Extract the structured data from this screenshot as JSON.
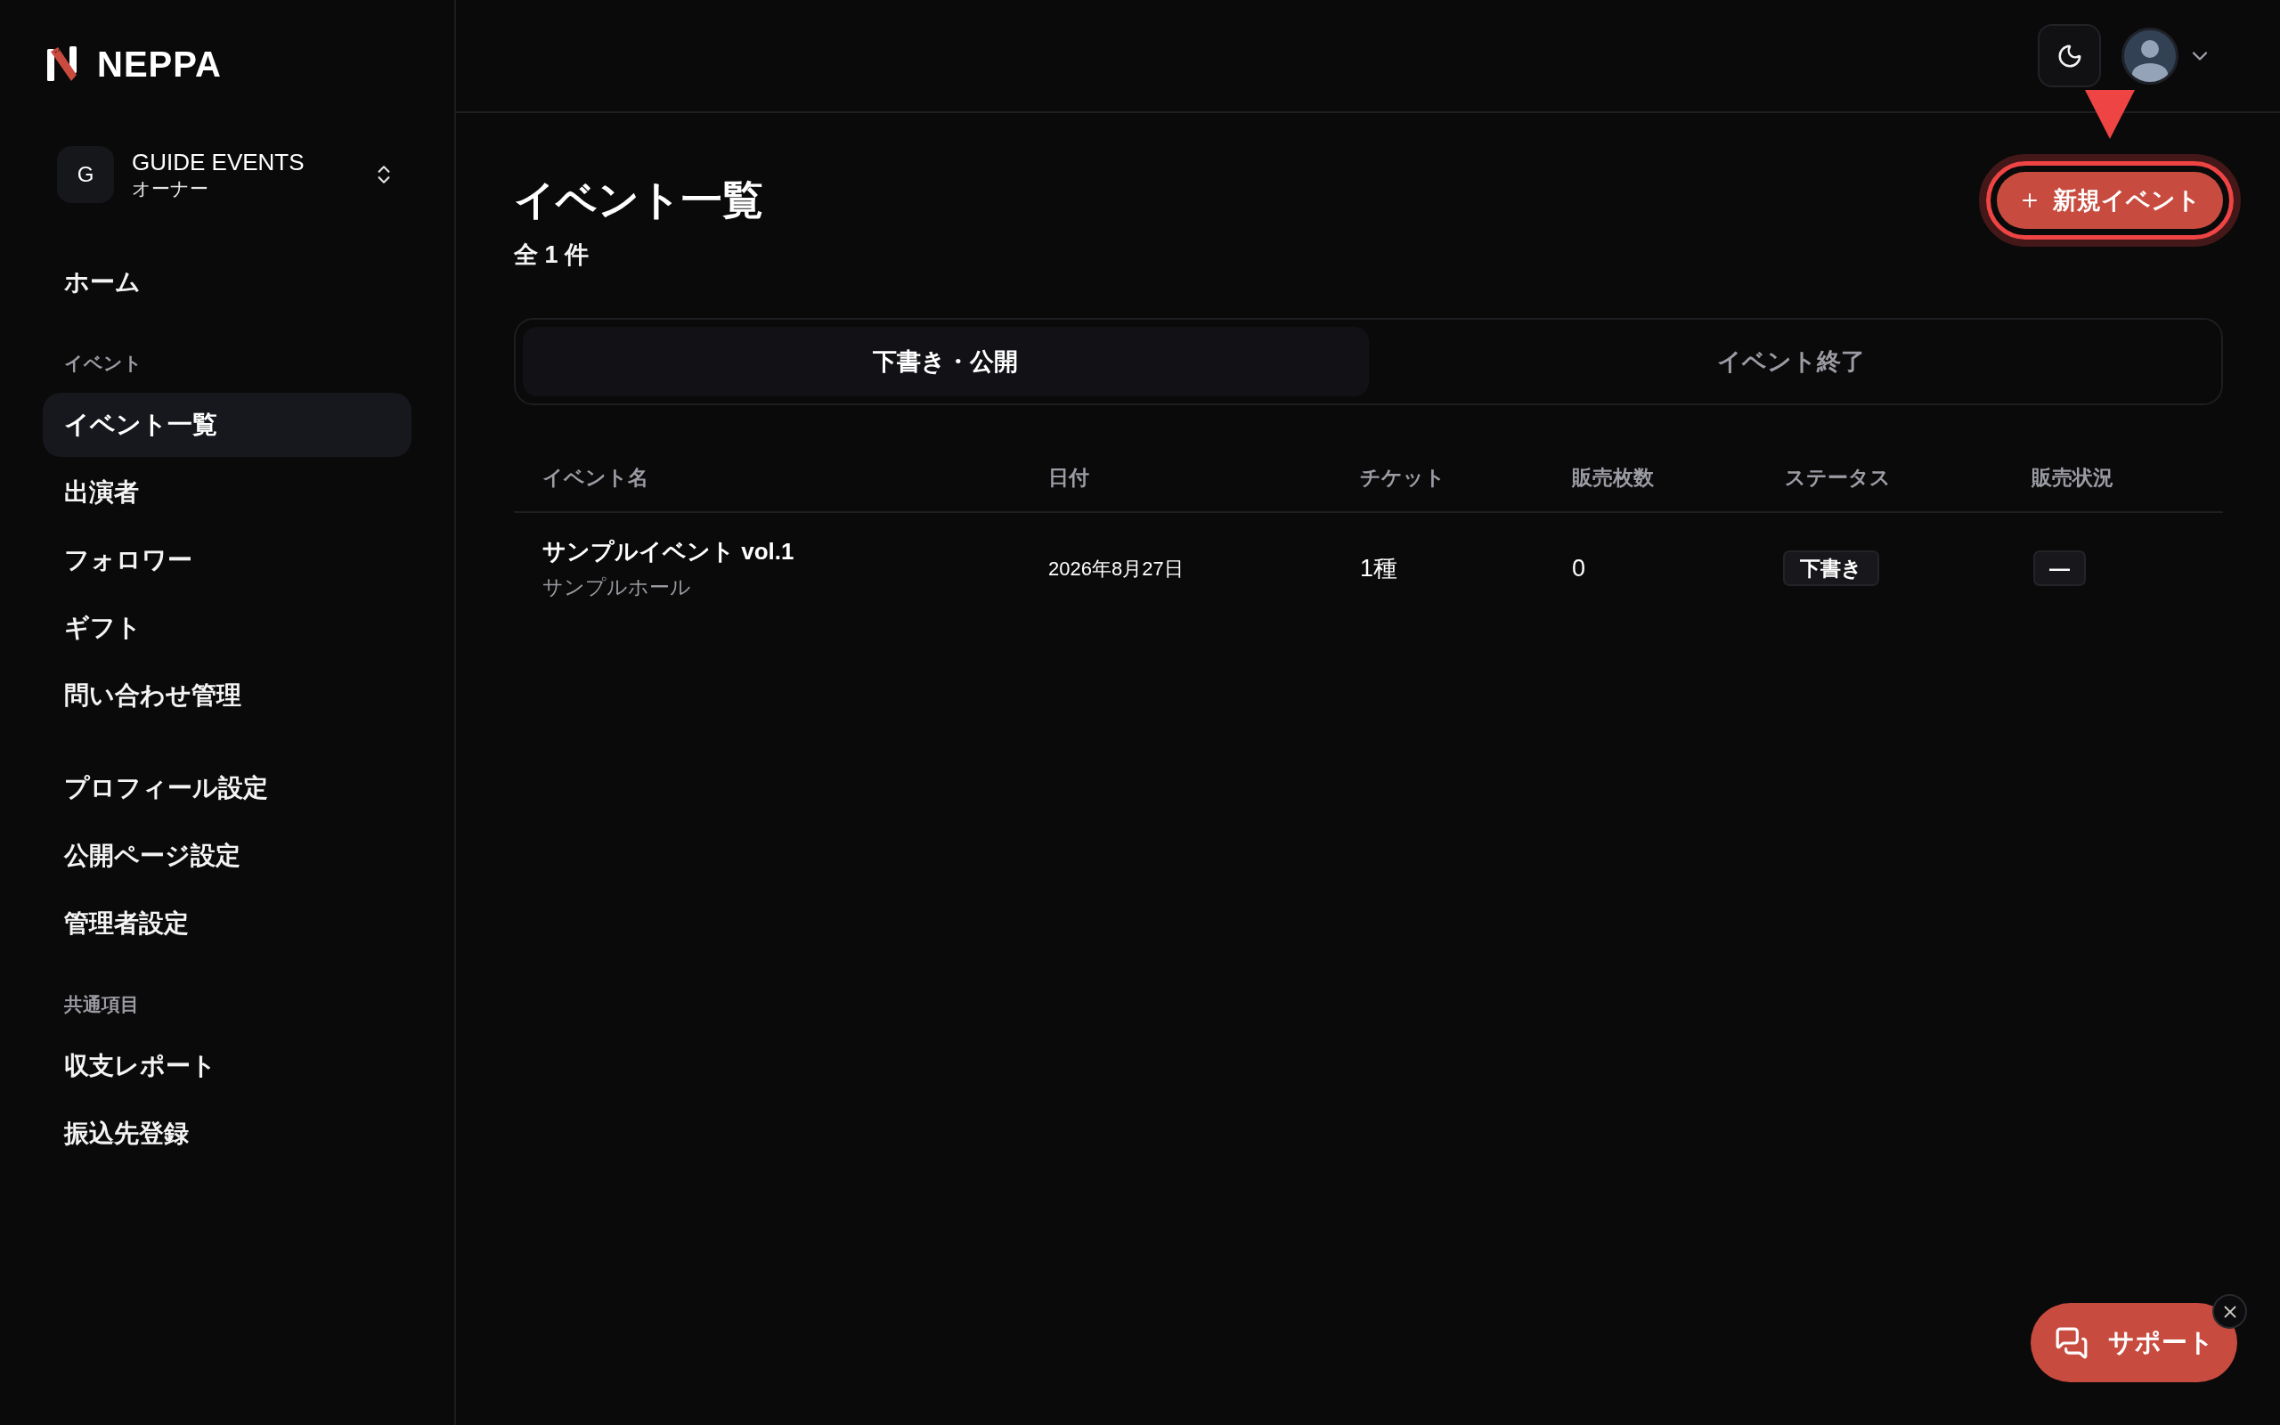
{
  "brand": {
    "name": "NEPPA"
  },
  "org_switcher": {
    "initial": "G",
    "name": "GUIDE EVENTS",
    "role": "オーナー"
  },
  "sidebar": {
    "groups": [
      {
        "items": [
          {
            "label": "ホーム",
            "selected": false
          }
        ]
      },
      {
        "label": "イベント",
        "items": [
          {
            "label": "イベント一覧",
            "selected": true
          },
          {
            "label": "出演者",
            "selected": false
          },
          {
            "label": "フォロワー",
            "selected": false
          },
          {
            "label": "ギフト",
            "selected": false
          },
          {
            "label": "問い合わせ管理",
            "selected": false
          }
        ]
      },
      {
        "items": [
          {
            "label": "プロフィール設定",
            "selected": false
          },
          {
            "label": "公開ページ設定",
            "selected": false
          },
          {
            "label": "管理者設定",
            "selected": false
          }
        ]
      },
      {
        "label": "共通項目",
        "items": [
          {
            "label": "収支レポート",
            "selected": false
          },
          {
            "label": "振込先登録",
            "selected": false
          }
        ]
      }
    ]
  },
  "page": {
    "title": "イベント一覧",
    "count": "全 1 件",
    "new_button": {
      "label": "新規イベント",
      "highlighted": true
    }
  },
  "tabs": [
    {
      "label": "下書き・公開",
      "selected": true
    },
    {
      "label": "イベント終了",
      "selected": false
    }
  ],
  "table": {
    "columns": [
      "イベント名",
      "日付",
      "チケット",
      "販売枚数",
      "ステータス",
      "販売状況"
    ],
    "rows": [
      {
        "name": "サンプルイベント vol.1",
        "venue": "サンプルホール",
        "date": "2026年8月27日",
        "tickets": "1種",
        "sold": "0",
        "status": "下書き",
        "sales_status": "—"
      }
    ]
  },
  "support": {
    "label": "サポート"
  }
}
